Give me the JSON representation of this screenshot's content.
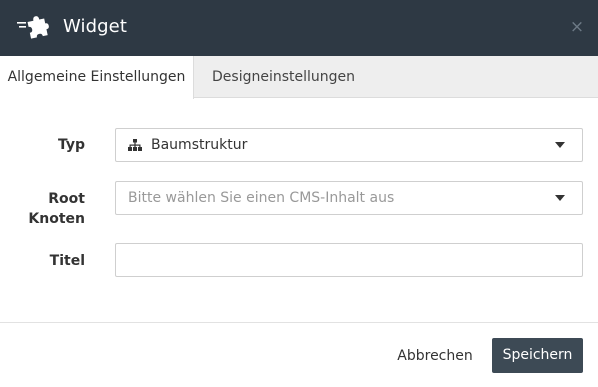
{
  "dialog": {
    "title": "Widget",
    "logo_icon": "puzzle-icon",
    "close_icon": "close-icon",
    "close_glyph": "×"
  },
  "tabs": [
    {
      "label": "Allgemeine Einstellungen",
      "active": true
    },
    {
      "label": "Designeinstellungen",
      "active": false
    }
  ],
  "form": {
    "type": {
      "label": "Typ",
      "value": "Baumstruktur",
      "icon": "sitemap-icon"
    },
    "root": {
      "label_line1": "Root",
      "label_line2": "Knoten",
      "placeholder": "Bitte wählen Sie einen CMS-Inhalt aus"
    },
    "title": {
      "label": "Titel",
      "value": ""
    }
  },
  "footer": {
    "cancel_label": "Abbrechen",
    "save_label": "Speichern"
  },
  "colors": {
    "header_bg": "#2e3944",
    "save_bg": "#3d4a55",
    "tabbar_bg": "#eeeeee"
  }
}
